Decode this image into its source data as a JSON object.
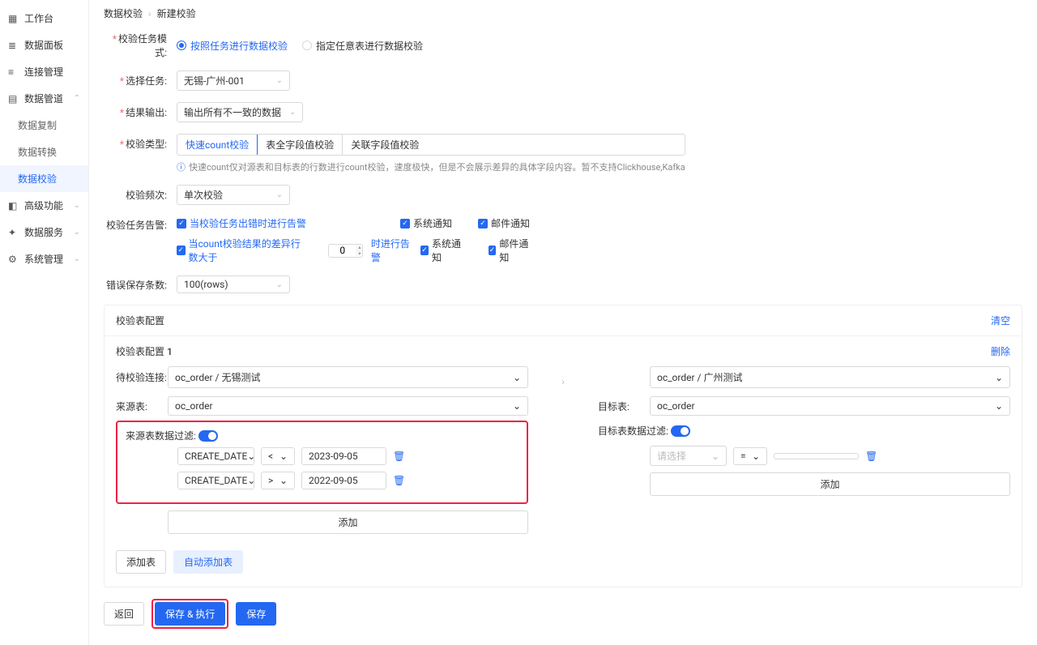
{
  "breadcrumb": {
    "a": "数据校验",
    "b": "新建校验"
  },
  "sidebar": {
    "items": [
      {
        "label": "工作台"
      },
      {
        "label": "数据面板"
      },
      {
        "label": "连接管理"
      },
      {
        "label": "数据管道"
      },
      {
        "label": "数据复制"
      },
      {
        "label": "数据转换"
      },
      {
        "label": "数据校验"
      },
      {
        "label": "高级功能"
      },
      {
        "label": "数据服务"
      },
      {
        "label": "系统管理"
      }
    ]
  },
  "form": {
    "task_mode_label": "校验任务模式:",
    "radio_a": "按照任务进行数据校验",
    "radio_b": "指定任意表进行数据校验",
    "select_task_label": "选择任务:",
    "select_task_value": "无锡-广州-001",
    "result_out_label": "结果输出:",
    "result_out_value": "输出所有不一致的数据",
    "type_label": "校验类型:",
    "type_opts": [
      "快速count校验",
      "表全字段值校验",
      "关联字段值校验"
    ],
    "type_info": "快速count仅对源表和目标表的行数进行count校验，速度极快，但是不会展示差异的具体字段内容。暂不支持Clickhouse,Kafka",
    "freq_label": "校验频次:",
    "freq_value": "单次校验",
    "alarm_label": "校验任务告警:",
    "alarm_a": "当校验任务出错时进行告警",
    "alarm_b": "当count校验结果的差异行数大于",
    "alarm_b_post": "时进行告警",
    "alarm_num": "0",
    "sys_notify": "系统通知",
    "mail_notify": "邮件通知",
    "err_keep_label": "错误保存条数:",
    "err_keep_value": "100(rows)"
  },
  "panel": {
    "title": "校验表配置",
    "clear": "清空",
    "sub_title": "校验表配置 1",
    "delete": "删除",
    "src_conn_label": "待校验连接:",
    "src_conn_value": "oc_order / 无锡测试",
    "dst_conn_value": "oc_order / 广州测试",
    "src_tbl_label": "来源表:",
    "src_tbl_value": "oc_order",
    "dst_tbl_label": "目标表:",
    "dst_tbl_value": "oc_order",
    "src_filter_label": "来源表数据过滤:",
    "dst_filter_label": "目标表数据过滤:",
    "filters_src": [
      {
        "field": "CREATE_DATE",
        "op": "<",
        "val": "2023-09-05"
      },
      {
        "field": "CREATE_DATE",
        "op": ">",
        "val": "2022-09-05"
      }
    ],
    "filter_dst_placeholder": "请选择",
    "filter_dst_op": "=",
    "add": "添加",
    "add_table": "添加表",
    "auto_add": "自动添加表"
  },
  "footer": {
    "back": "返回",
    "save_run": "保存 & 执行",
    "save": "保存"
  }
}
